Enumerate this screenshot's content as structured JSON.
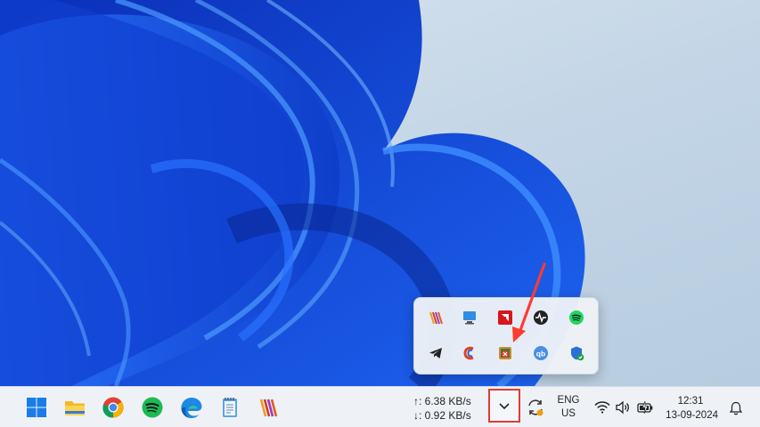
{
  "taskbar": {
    "apps": [
      {
        "name": "Start",
        "icon": "windows-logo-icon"
      },
      {
        "name": "File Explorer",
        "icon": "folder-icon"
      },
      {
        "name": "Google Chrome",
        "icon": "chrome-icon"
      },
      {
        "name": "Spotify",
        "icon": "spotify-icon"
      },
      {
        "name": "Microsoft Edge",
        "icon": "edge-icon"
      },
      {
        "name": "Notepad",
        "icon": "notepad-icon"
      },
      {
        "name": "WinDirStat-like app",
        "icon": "stripes-icon"
      }
    ],
    "net_upload": "↑: 6.38 KB/s",
    "net_download": "↓: 0.92 KB/s",
    "overflow_chevron": "⌄",
    "language_line1": "ENG",
    "language_line2": "US",
    "time": "12:31",
    "date": "13-09-2024"
  },
  "tray_flyout": {
    "icons": [
      "stripes-app-icon",
      "monitor-app-icon",
      "amd-icon",
      "activity-icon",
      "spotify-icon",
      "telegram-icon",
      "ccleaner-icon",
      "disabled-app-icon",
      "qbittorrent-icon",
      "windows-security-icon"
    ]
  },
  "colors": {
    "highlight": "#e53935",
    "taskbar_bg": "#eef2f7",
    "wallpaper_blue": "#1a55e3"
  }
}
